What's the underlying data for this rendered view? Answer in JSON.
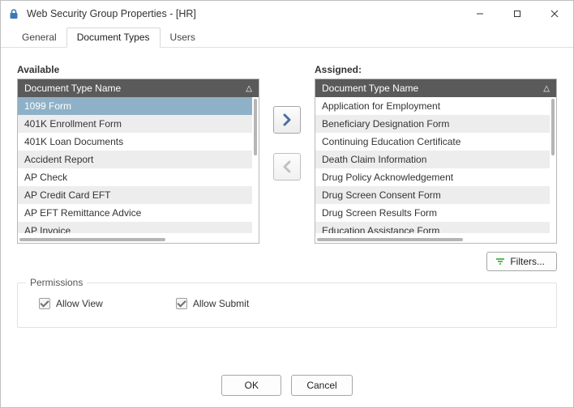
{
  "window": {
    "title": "Web Security Group Properties - [HR]"
  },
  "tabs": [
    {
      "label": "General",
      "active": false
    },
    {
      "label": "Document Types",
      "active": true
    },
    {
      "label": "Users",
      "active": false
    }
  ],
  "dual": {
    "available": {
      "label": "Available",
      "header": "Document Type Name",
      "items": [
        "1099 Form",
        "401K Enrollment Form",
        "401K Loan Documents",
        "Accident Report",
        "AP Check",
        "AP Credit Card EFT",
        "AP EFT Remittance Advice",
        "AP Invoice"
      ],
      "selected_index": 0
    },
    "assigned": {
      "label": "Assigned:",
      "header": "Document Type Name",
      "items": [
        "Application for Employment",
        "Beneficiary Designation Form",
        "Continuing Education Certificate",
        "Death Claim Information",
        "Drug Policy Acknowledgement",
        "Drug Screen Consent Form",
        "Drug Screen Results Form",
        "Education Assistance Form"
      ],
      "selected_index": -1
    }
  },
  "buttons": {
    "filters": "Filters...",
    "ok": "OK",
    "cancel": "Cancel"
  },
  "permissions": {
    "legend": "Permissions",
    "allow_view": {
      "label": "Allow View",
      "checked": true
    },
    "allow_submit": {
      "label": "Allow Submit",
      "checked": true
    }
  }
}
